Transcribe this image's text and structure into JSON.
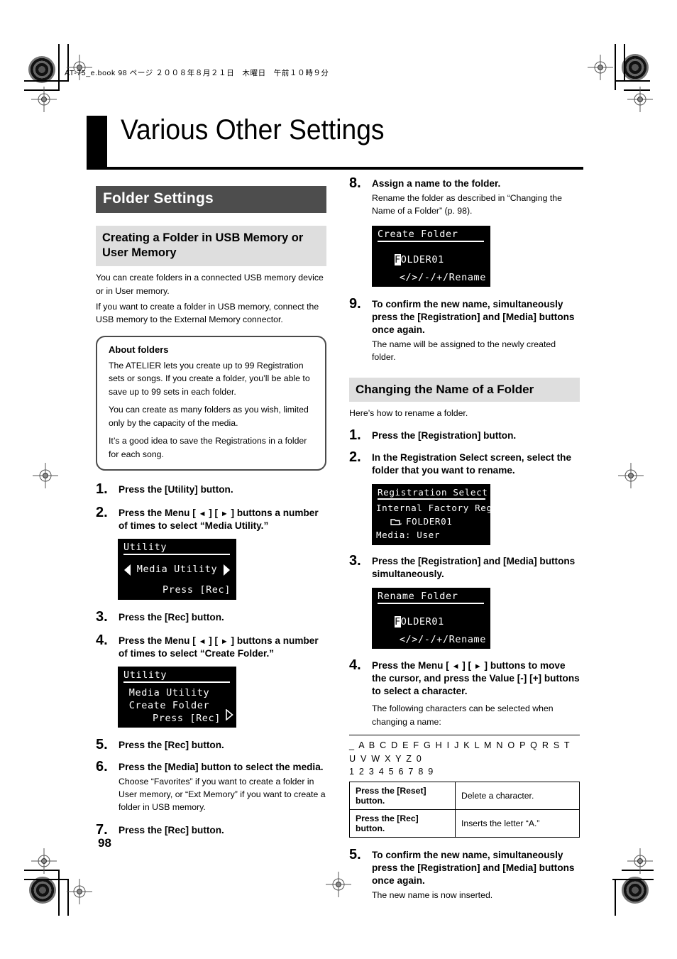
{
  "print_header": {
    "file_line": "AT-75_e.book  98 ページ  ２００８年８月２１日　木曜日　午前１０時９分"
  },
  "chapter": {
    "title": "Various Other Settings"
  },
  "page_number": "98",
  "left_column": {
    "section_bar": "Folder Settings",
    "sub_heading": "Creating a Folder in USB Memory or User Memory",
    "intro_1": "You can create folders in a connected USB memory device or in User memory.",
    "intro_2": "If you want to create a folder in USB memory, connect the USB memory to the External Memory connector.",
    "note": {
      "title": "About folders",
      "p1": "The ATELIER lets you create up to 99 Registration sets or songs. If you create a folder, you’ll be able to save up to 99 sets in each folder.",
      "p2": "You can create as many folders as you wish, limited only by the capacity of the media.",
      "p3": "It’s a good idea to save the Registrations in a folder for each song."
    },
    "steps": [
      {
        "num": "1.",
        "lead": "Press the [Utility] button."
      },
      {
        "num": "2.",
        "lead_pre": "Press the Menu [ ",
        "lead_mid": " ] [ ",
        "lead_post": " ] buttons a number of times to select “Media Utility.”"
      },
      {
        "num": "3.",
        "lead": "Press the [Rec] button."
      },
      {
        "num": "4.",
        "lead_pre": "Press the Menu [ ",
        "lead_mid": " ] [ ",
        "lead_post": " ] buttons a number of times to select “Create Folder.”"
      },
      {
        "num": "5.",
        "lead": "Press the [Rec] button."
      },
      {
        "num": "6.",
        "lead": "Press the [Media] button to select the media.",
        "sub": "Choose “Favorites” if you want to create a folder in User memory, or “Ext Memory” if you want to create a folder in USB memory."
      },
      {
        "num": "7.",
        "lead": "Press the [Rec] button."
      }
    ],
    "lcd_utility_1": {
      "title": "Utility",
      "line_center": "Media Utility",
      "line_bottom": "Press [Rec]",
      "left_arrow": "left-triangle",
      "right_arrow": "right-triangle"
    },
    "lcd_utility_2": {
      "title": "Utility",
      "line_1": "Media Utility",
      "line_2": "Create Folder",
      "line_3": "Press [Rec]",
      "right_arrow": "right-triangle-outline"
    }
  },
  "right_column": {
    "steps_create": [
      {
        "num": "8.",
        "lead": "Assign a name to the folder.",
        "sub": "Rename the folder as described in “Changing the Name of a Folder” (p. 98)."
      },
      {
        "num": "9.",
        "lead": "To confirm the new name, simultaneously press the [Registration] and [Media] buttons once again.",
        "sub": "The name will be assigned to the newly created folder."
      }
    ],
    "lcd_create_folder": {
      "title": "Create Folder",
      "name_cursor": "F",
      "name_rest": "OLDER01",
      "footer": "</>/-/+/Rename"
    },
    "sub_heading": "Changing the Name of a Folder",
    "intro": "Here’s how to rename a folder.",
    "steps_rename": [
      {
        "num": "1.",
        "lead": "Press the [Registration] button."
      },
      {
        "num": "2.",
        "lead": "In the Registration Select screen, select the folder that you want to rename."
      },
      {
        "num": "3.",
        "lead": "Press the [Registration] and [Media] buttons simultaneously."
      },
      {
        "num": "4.",
        "lead_pre": "Press the Menu [ ",
        "lead_mid": " ] [ ",
        "lead_post": " ] buttons to move the cursor, and press the Value [-] [+] buttons to select a character.",
        "sub": "The following characters can be selected when changing a name:"
      },
      {
        "num": "5.",
        "lead": "To confirm the new name, simultaneously press the [Registration] and [Media] buttons once again.",
        "sub": "The new name is now inserted."
      }
    ],
    "lcd_registration_select": {
      "title": "Registration Select",
      "line_1": "Internal Factory Reg.",
      "folder_icon": "folder-icon",
      "line_2": "FOLDER01",
      "line_3": "Media: User"
    },
    "lcd_rename_folder": {
      "title": "Rename Folder",
      "name_cursor": "F",
      "name_rest": "OLDER01",
      "footer": "</>/-/+/Rename"
    },
    "character_set": {
      "line_1": "_ A B C D E F G H I J K L M N O P Q R S T U V W X Y Z 0",
      "line_2": "1 2 3 4 5 6 7 8 9"
    },
    "key_table": {
      "rows": [
        {
          "key": "Press the [Reset] button.",
          "desc": "Delete a character."
        },
        {
          "key": "Press the [Rec] button.",
          "desc": "Inserts the letter “A.”"
        }
      ]
    }
  },
  "glyphs": {
    "left_tri": "◄",
    "right_tri": "►"
  }
}
